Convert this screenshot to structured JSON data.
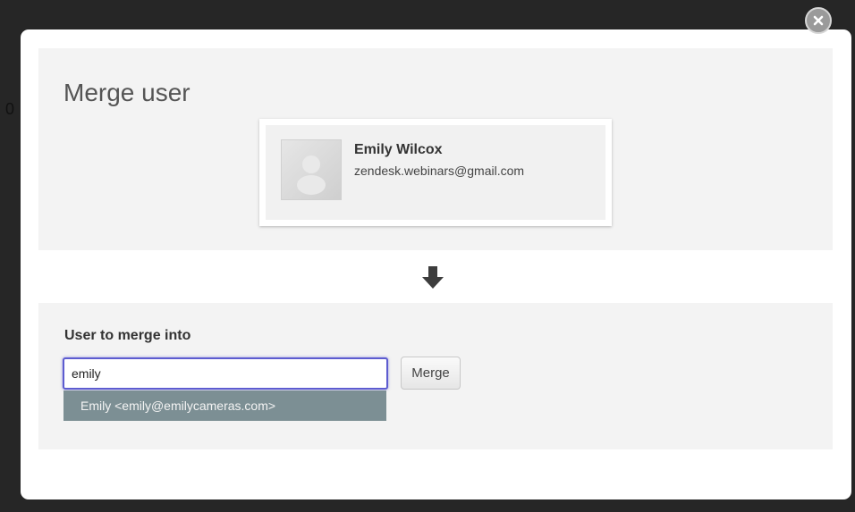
{
  "background": {
    "edge_text": "0"
  },
  "modal": {
    "close_icon": "close-icon",
    "title": "Merge user",
    "source_user": {
      "name": "Emily Wilcox",
      "email": "zendesk.webinars@gmail.com",
      "avatar_icon": "default-avatar-icon"
    },
    "arrow_icon": "arrow-down-icon",
    "target": {
      "label": "User to merge into",
      "input_value": "emily",
      "merge_button_label": "Merge",
      "suggestions": [
        "Emily <emily@emilycameras.com>"
      ]
    }
  },
  "colors": {
    "input_focus": "#5d5cd0",
    "suggestion_bg": "#7c8f94",
    "section_bg": "#f3f3f3"
  }
}
